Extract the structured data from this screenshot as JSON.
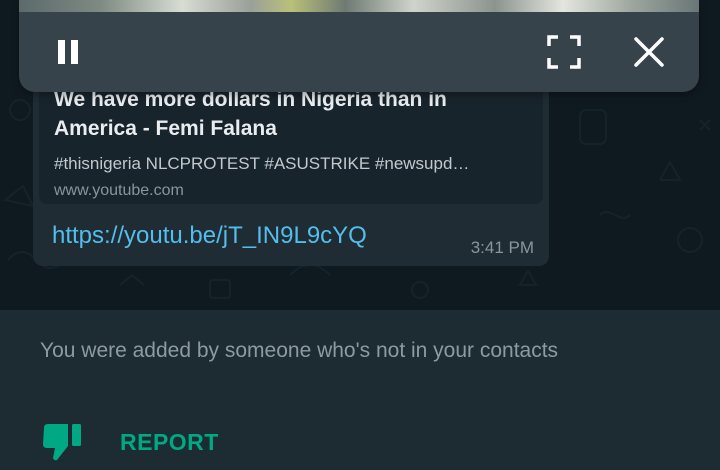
{
  "pip": {
    "pause_icon": "pause-icon",
    "fullscreen_icon": "fullscreen-icon",
    "close_icon": "close-icon"
  },
  "message": {
    "preview_title": "We have more dollars in Nigeria than in\nAmerica - Femi Falana",
    "preview_description": "#thisnigeria NLCPROTEST #ASUSTRIKE #newsupd…",
    "preview_domain": "www.youtube.com",
    "link": "https://youtu.be/jT_IN9L9cYQ",
    "time": "3:41 PM"
  },
  "notice": {
    "text": "You were added by someone who's not in your contacts",
    "report_label": "REPORT",
    "report_icon": "thumbs-down-icon"
  },
  "colors": {
    "accent": "#00a884",
    "link": "#53bdeb",
    "bubble": "#1f2c34",
    "chat_background": "#0f1a20",
    "pip_controls": "#36434b"
  }
}
